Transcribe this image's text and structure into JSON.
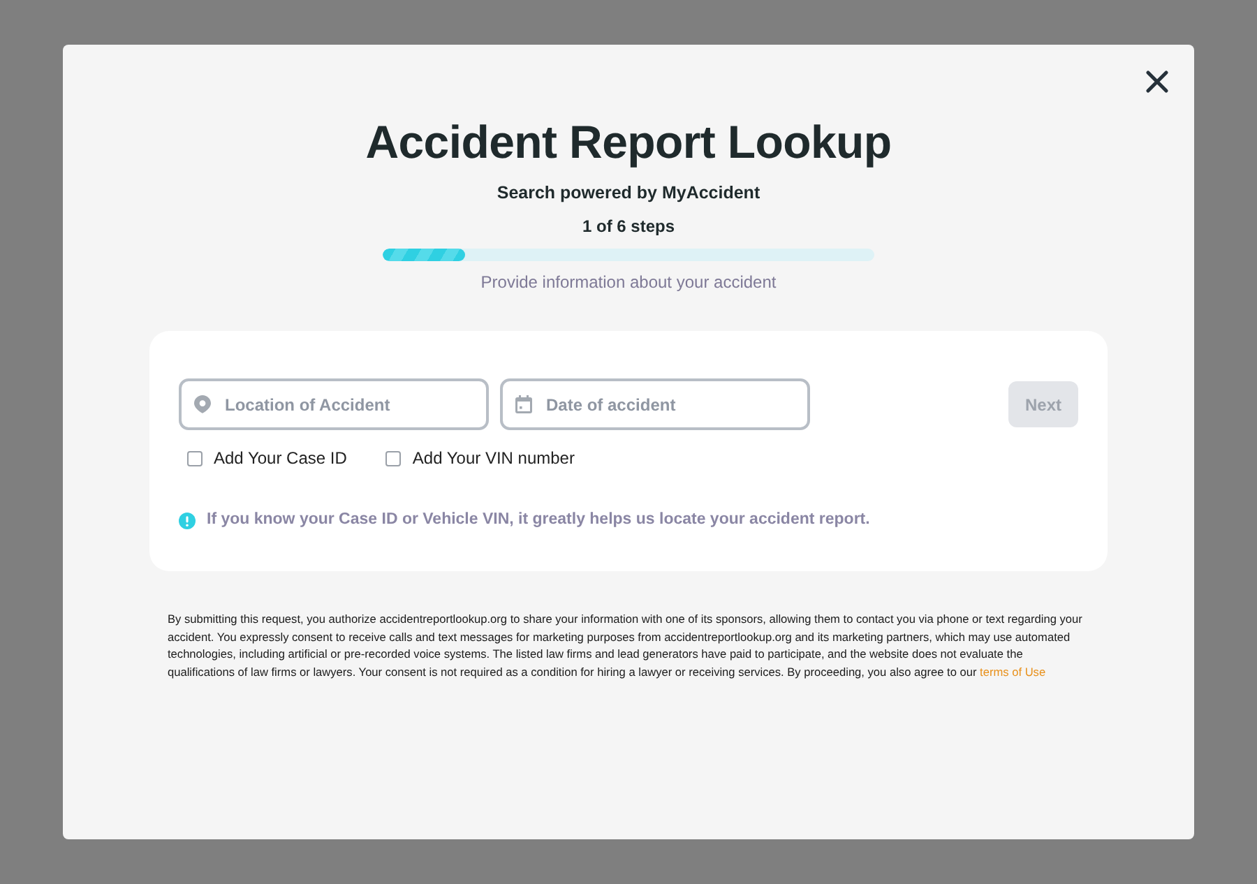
{
  "modal": {
    "title": "Accident Report Lookup",
    "subtitle": "Search powered by MyAccident",
    "step_label": "1 of 6 steps",
    "progress": {
      "level": 0.167
    },
    "caption": "Provide information about your accident"
  },
  "form": {
    "fields": [
      {
        "kind": "location",
        "placeholder": "Location of Accident"
      },
      {
        "kind": "date",
        "placeholder": "Date of accident"
      }
    ],
    "next_button": {
      "label": "Next",
      "disabled": true
    },
    "options": [
      {
        "label": "Add Your Case ID",
        "checked": false
      },
      {
        "label": "Add Your VIN number",
        "checked": false
      }
    ],
    "info": "If you know your Case ID or Vehicle VIN, it greatly helps us locate your accident report."
  },
  "disclaimer": {
    "text": "By submitting this request, you authorize accidentreportlookup.org to share your information with one of its sponsors, allowing them to contact you via phone or text regarding your accident. You expressly consent to receive calls and text messages for marketing purposes from accidentreportlookup.org and its marketing partners, which may use automated technologies, including artificial or pre-recorded voice systems. The listed law firms and lead generators have paid to participate, and the website does not evaluate the qualifications of law firms or lawyers. Your consent is not required as a condition for hiring a lawyer or receiving services. By proceeding, you also agree to our",
    "link": "terms of Use"
  }
}
